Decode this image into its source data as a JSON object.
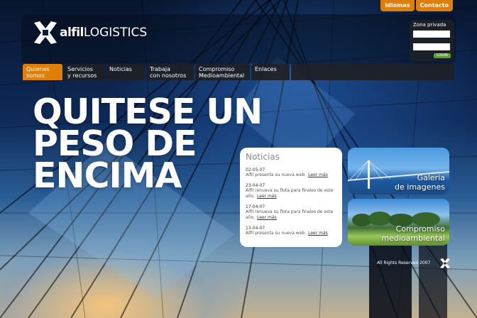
{
  "header": {
    "logo": {
      "brand": "alfil",
      "suffix": "LOGISTICS",
      "icon": "alfil-logo-icon"
    },
    "top_links": [
      "Idiomas",
      "Contacto"
    ]
  },
  "login": {
    "title": "Zona privada",
    "user_value": "",
    "password_value": "",
    "button_label": "LOGIN"
  },
  "nav": {
    "items": [
      {
        "line1": "Quienes",
        "line2": "somos",
        "active": true
      },
      {
        "line1": "Servicios",
        "line2": "y recursos",
        "active": false
      },
      {
        "line1": "Noticias",
        "line2": "",
        "active": false
      },
      {
        "line1": "Trabaja",
        "line2": "con nosotros",
        "active": false
      },
      {
        "line1": "Compromiso",
        "line2": "Medioambiental",
        "active": false
      },
      {
        "line1": "Enlaces",
        "line2": "",
        "active": false
      }
    ]
  },
  "hero": {
    "lines": [
      "QUITESE UN",
      "PESO DE",
      "ENCIMA"
    ]
  },
  "news": {
    "title": "Noticias",
    "more_label": "Leer más",
    "items": [
      {
        "date": "02-05-07",
        "text": "Alfil presenta su nueva web."
      },
      {
        "date": "23-04-07",
        "text": "Alfil renueva su flota para finales de este año."
      },
      {
        "date": "17-04-07",
        "text": "Alfil renueva su flota para finales de este año."
      },
      {
        "date": "13-04-07",
        "text": "Alfil presenta su nueva web."
      }
    ]
  },
  "promos": {
    "gallery": {
      "line1": "Galeria",
      "line2": "de imagenes"
    },
    "eco": {
      "line1": "Compromiso",
      "line2": "medioambiental"
    }
  },
  "footer": {
    "rights": "All Rights Reserved 2007"
  },
  "colors": {
    "accent": "#e07e0a",
    "nav_bg": "#1e2026",
    "login_btn": "#5fa02a"
  }
}
